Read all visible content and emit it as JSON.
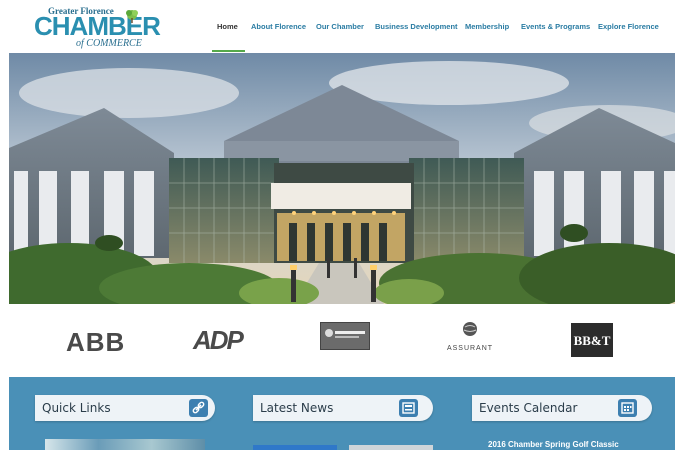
{
  "header": {
    "logo": {
      "line1": "Greater Florence",
      "line2": "CHAMBER",
      "line3": "of COMMERCE",
      "icon": "leaf-icon"
    },
    "nav": [
      {
        "label": "Home",
        "active": true
      },
      {
        "label": "About Florence",
        "active": false
      },
      {
        "label": "Our Chamber",
        "active": false
      },
      {
        "label": "Business Development",
        "active": false
      },
      {
        "label": "Membership",
        "active": false
      },
      {
        "label": "Events & Programs",
        "active": false
      },
      {
        "label": "Explore Florence",
        "active": false
      }
    ],
    "colors": {
      "accent": "#2a7ca3",
      "active_underline": "#55a94a"
    }
  },
  "hero": {
    "alt": "Florence Center building at dusk"
  },
  "sponsors": [
    {
      "name": "ABB"
    },
    {
      "name": "ADP"
    },
    {
      "name": "",
      "icon": "sponsor-logo-icon"
    },
    {
      "name": "ASSURANT"
    },
    {
      "name": "BB&T"
    }
  ],
  "boxes": [
    {
      "title": "Quick Links",
      "icon": "link-icon"
    },
    {
      "title": "Latest News",
      "icon": "news-icon"
    },
    {
      "title": "Events Calendar",
      "icon": "calendar-icon"
    }
  ],
  "events": {
    "first": "2016 Chamber Spring Golf Classic"
  },
  "colors": {
    "panel": "#4a90b7",
    "box": "#eef3f7"
  }
}
